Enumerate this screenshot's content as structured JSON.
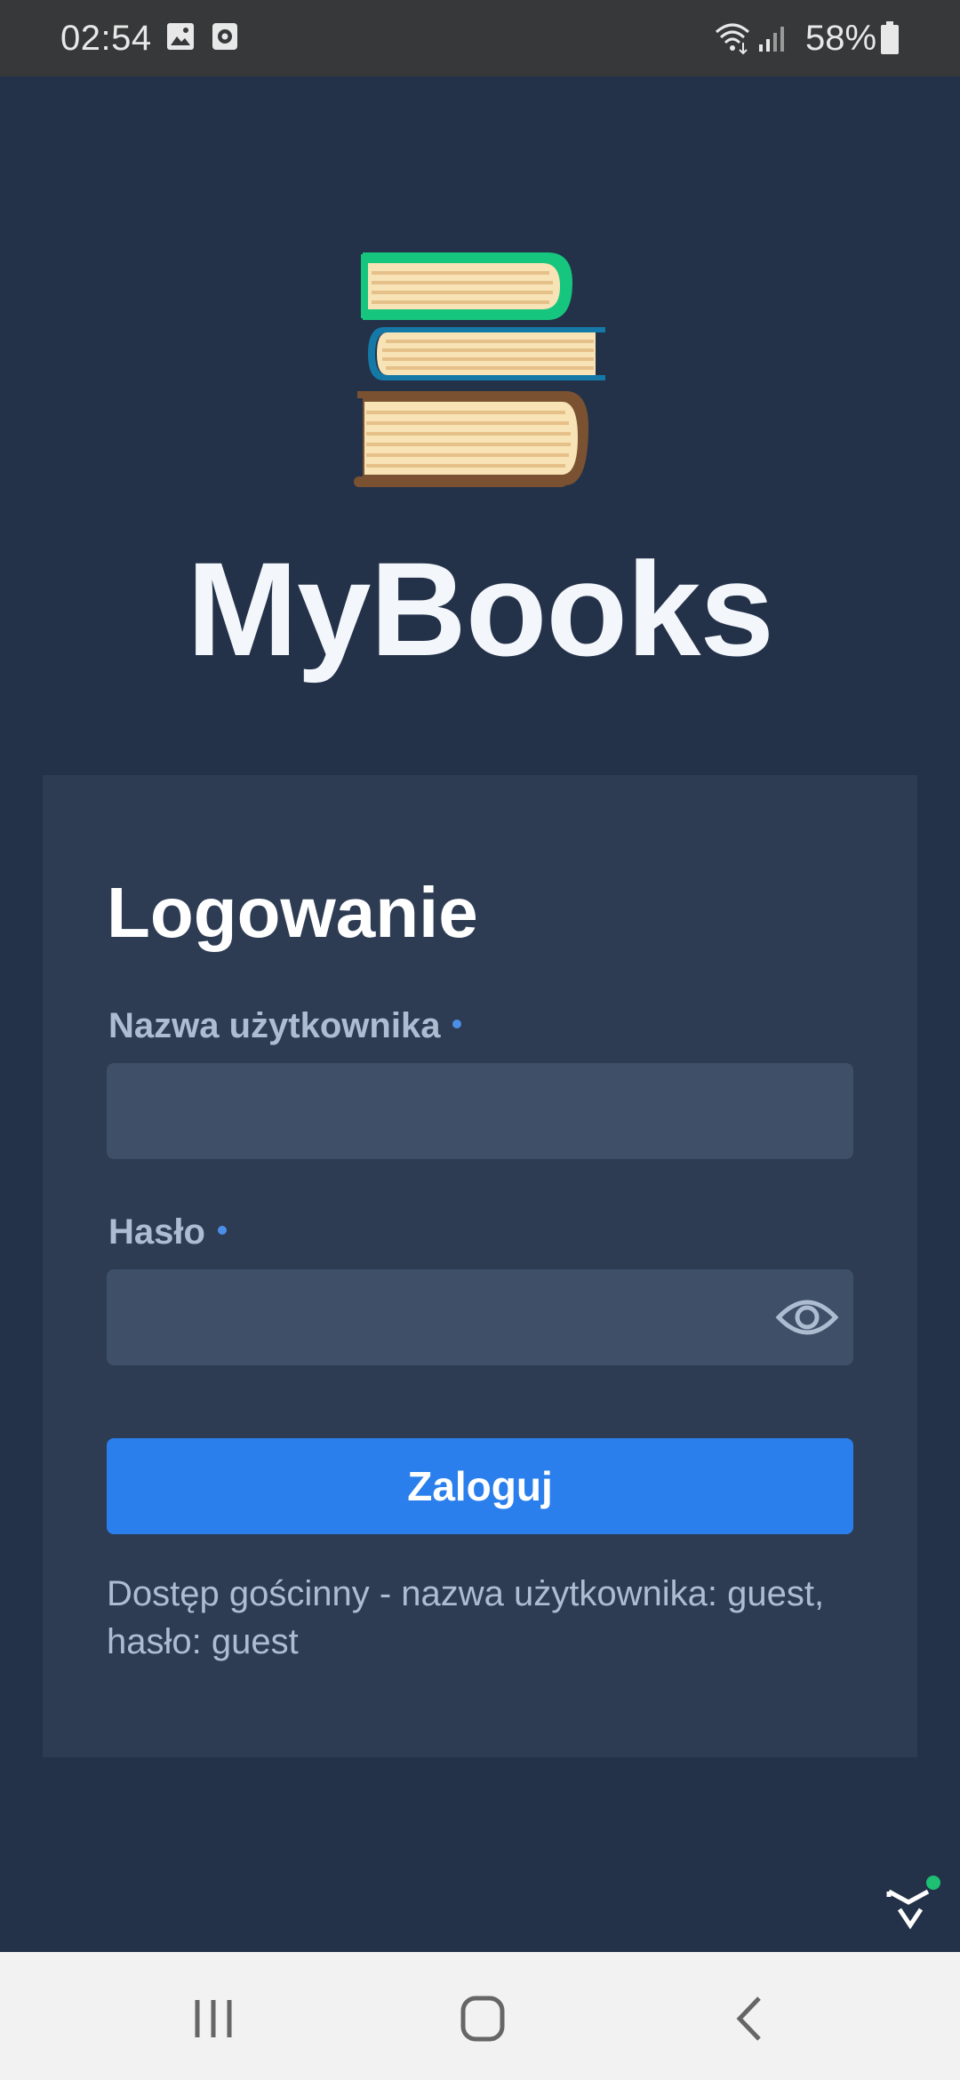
{
  "status_bar": {
    "time": "02:54",
    "battery_percent": "58%",
    "icons": [
      "image-icon",
      "recorder-icon",
      "wifi-icon",
      "signal-icon",
      "battery-icon"
    ]
  },
  "app": {
    "title": "MyBooks",
    "logo_icon": "book-stack-icon",
    "colors": {
      "background": "#233249",
      "card": "#2d3c53",
      "field": "#3e4f67",
      "accent": "#2a7fec",
      "label": "#aebcd1"
    }
  },
  "login": {
    "heading": "Logowanie",
    "username_label": "Nazwa użytkownika",
    "username_value": "",
    "password_label": "Hasło",
    "password_value": "",
    "submit_label": "Zaloguj",
    "guest_hint": "Dostęp gościnny - nazwa użytkownika: guest, hasło: guest"
  },
  "nav_bar": {
    "buttons": [
      "recent-apps",
      "home",
      "back"
    ]
  }
}
